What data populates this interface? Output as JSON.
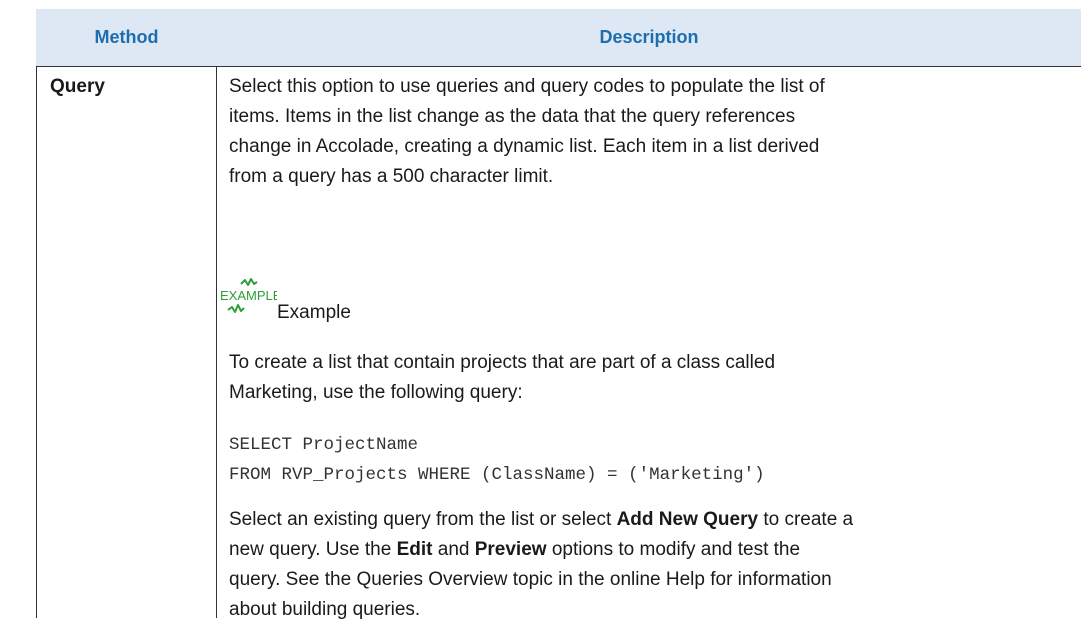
{
  "table": {
    "header": {
      "method": "Method",
      "description": "Description"
    },
    "row": {
      "method": "Query",
      "intro_lines": [
        "Select this option to use queries and query codes to populate the list of",
        "items. Items in the list change as the data that the query references",
        "change in Accolade, creating a dynamic list. Each item in a list derived",
        "from a query has a 500 character limit."
      ],
      "example_icon_text": "EXAMPLE",
      "example_label": "Example",
      "example_intro_lines": [
        "To create a list that contain projects that are part of a class called",
        "Marketing, use the following query:"
      ],
      "code_lines": [
        "SELECT ProjectName",
        "FROM RVP_Projects WHERE (ClassName) = ('Marketing')"
      ],
      "outro": {
        "line1_a": "Select an existing query from the list or select ",
        "line1_bold": "Add New Query",
        "line1_b": " to create a",
        "line2_a": "new query. Use the ",
        "line2_bold1": "Edit",
        "line2_b": " and ",
        "line2_bold2": "Preview",
        "line2_c": " options to modify and test the",
        "line3": "query. See the Queries Overview topic in the online Help for information",
        "line4": "about building queries."
      }
    }
  },
  "colors": {
    "header_bg": "#dde8f4",
    "header_text": "#1d6eb0",
    "icon_green": "#2e9e3a"
  }
}
